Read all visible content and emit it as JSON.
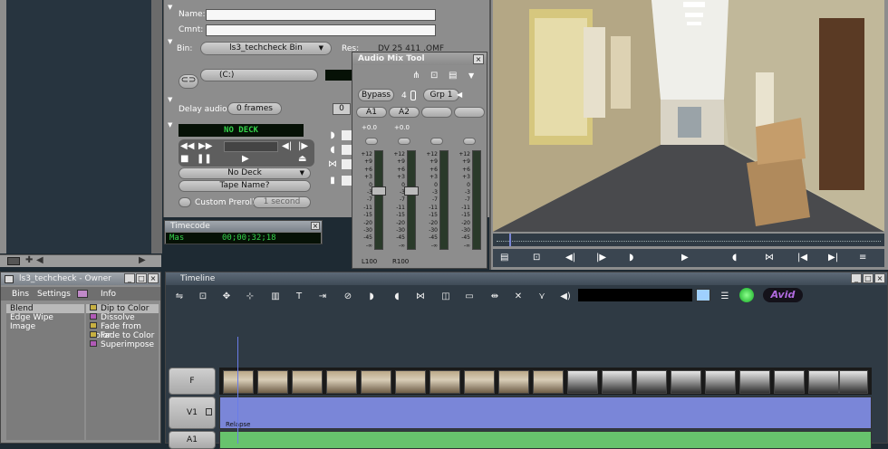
{
  "bin_window": {
    "labels": [
      "Name:",
      "Cmnt:",
      "Bin:",
      "Res:",
      "Delay audio:"
    ],
    "bin_value": "ls3_techcheck Bin",
    "res_value": "DV 25 411 .OMF",
    "delay_value": "0 frames",
    "delay_count": "0",
    "path_value": "(C:)",
    "deck_status": "NO DECK",
    "deck_select": "No Deck",
    "tape_button": "Tape Name?",
    "custom_preroll": "Custom Preroll",
    "preroll_value": "1 second"
  },
  "audio_mix": {
    "title": "Audio Mix Tool",
    "bypass": "Bypass",
    "channel_count": "4",
    "group": "Grp 1",
    "channels": [
      {
        "label": "A1",
        "gain": "+0.0",
        "pan": "L100"
      },
      {
        "label": "A2",
        "gain": "+0.0",
        "pan": "R100"
      },
      {
        "label": "",
        "gain": "",
        "pan": ""
      },
      {
        "label": "",
        "gain": "",
        "pan": ""
      }
    ],
    "scale": [
      "+12",
      "+9",
      "+6",
      "+3",
      "0",
      "-3",
      "-7",
      "-11",
      "-15",
      "-20",
      "-30",
      "-45",
      "-∞"
    ]
  },
  "timecode": {
    "title": "Timecode",
    "label": "Mas",
    "value": "00;00;32;18"
  },
  "project": {
    "title": "ls3_techcheck - Owner",
    "tabs": [
      "Bins",
      "Settings",
      "",
      "Info"
    ],
    "categories": [
      "Blend",
      "Edge Wipe",
      "Image"
    ],
    "effects": [
      "Dip to Color",
      "Dissolve",
      "Fade from Color",
      "Fade to Color",
      "Superimpose"
    ]
  },
  "timeline": {
    "title": "Timeline",
    "tracks": [
      "F",
      "V1",
      "A1"
    ],
    "clip_name": "Relapse",
    "brand": "Avid"
  },
  "colors": {
    "accent": "#7a86d8",
    "audio_track": "#67c36d",
    "lcd_green": "#34d34a"
  }
}
